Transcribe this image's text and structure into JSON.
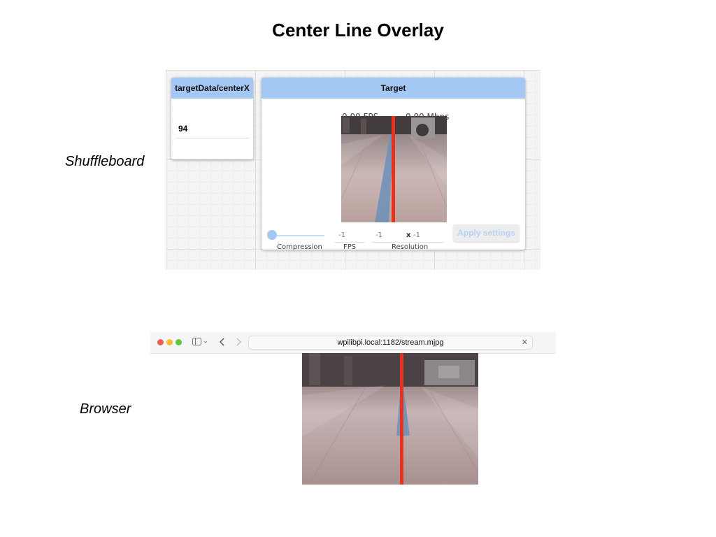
{
  "slide": {
    "title": "Center Line Overlay",
    "shuffleboard_label": "Shuffleboard",
    "browser_label": "Browser"
  },
  "shuffleboard": {
    "nt_tile": {
      "title": "targetData/centerX",
      "value": "94"
    },
    "camera_tile": {
      "title": "Target",
      "fps": "0.00 FPS",
      "bandwidth": "0.00 Mbps",
      "compression_label": "Compression",
      "compression_level": 0,
      "fps_value": "-1",
      "fps_label": "FPS",
      "width_value": "-1",
      "resolution_separator": "x",
      "height_value": "-1",
      "resolution_label": "Resolution",
      "apply_label": "Apply settings",
      "accent_color": "#a4c8f4"
    }
  },
  "browser": {
    "url": "wpilibpi.local:1182/stream.mjpg",
    "traffic_lights": [
      "#ee5f57",
      "#f5bd30",
      "#5fc83f"
    ],
    "overlay_color": "#e8321f"
  }
}
